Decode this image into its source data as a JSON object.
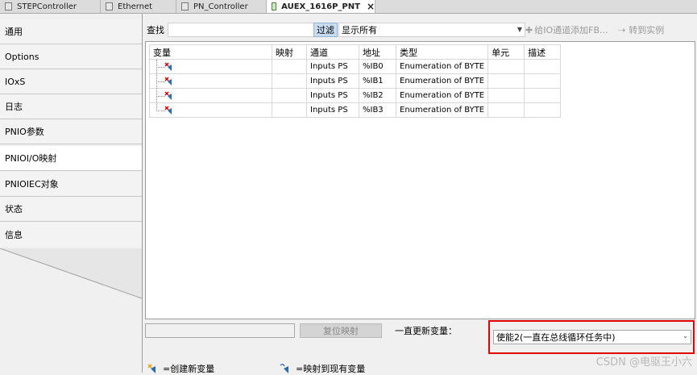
{
  "tabs": [
    {
      "label": "STEPController",
      "active": false
    },
    {
      "label": "Ethernet",
      "active": false
    },
    {
      "label": "PN_Controller",
      "active": false
    },
    {
      "label": "AUEX_1616P_PNT",
      "active": true
    }
  ],
  "sidebar": {
    "items": [
      {
        "label": "通用"
      },
      {
        "label": "Options"
      },
      {
        "label": "IOxS"
      },
      {
        "label": "日志"
      },
      {
        "label": "PNIO参数"
      },
      {
        "label": "PNIOI/O映射",
        "active": true
      },
      {
        "label": "PNIOIEC对象"
      },
      {
        "label": "状态"
      },
      {
        "label": "信息"
      }
    ]
  },
  "toolbar": {
    "search_label": "查找",
    "filter_label": "过滤",
    "filter_value": "显示所有",
    "add_fb_label": "给IO通道添加FB...",
    "goto_instance_label": "转到实例"
  },
  "table": {
    "headers": [
      "变量",
      "映射",
      "通道",
      "地址",
      "类型",
      "单元",
      "描述"
    ],
    "rows": [
      {
        "variable": "",
        "mapping": "",
        "channel": "Inputs PS",
        "address": "%IB0",
        "type": "Enumeration of BYTE",
        "unit": "",
        "desc": ""
      },
      {
        "variable": "",
        "mapping": "",
        "channel": "Inputs PS",
        "address": "%IB1",
        "type": "Enumeration of BYTE",
        "unit": "",
        "desc": ""
      },
      {
        "variable": "",
        "mapping": "",
        "channel": "Inputs PS",
        "address": "%IB2",
        "type": "Enumeration of BYTE",
        "unit": "",
        "desc": ""
      },
      {
        "variable": "",
        "mapping": "",
        "channel": "Inputs PS",
        "address": "%IB3",
        "type": "Enumeration of BYTE",
        "unit": "",
        "desc": ""
      }
    ]
  },
  "bottom": {
    "reset_mapping_label": "复位映射",
    "always_update_label": "一直更新变量：",
    "always_update_value": "使能2(一直在总线循环任务中)"
  },
  "legend": {
    "create_new_label": "=创建新变量",
    "map_existing_label": "=映射到现有变量"
  },
  "watermark": "CSDN @电驱王小六",
  "colors": {
    "highlight": "#e00000",
    "filter_button": "#c9dcf0"
  }
}
